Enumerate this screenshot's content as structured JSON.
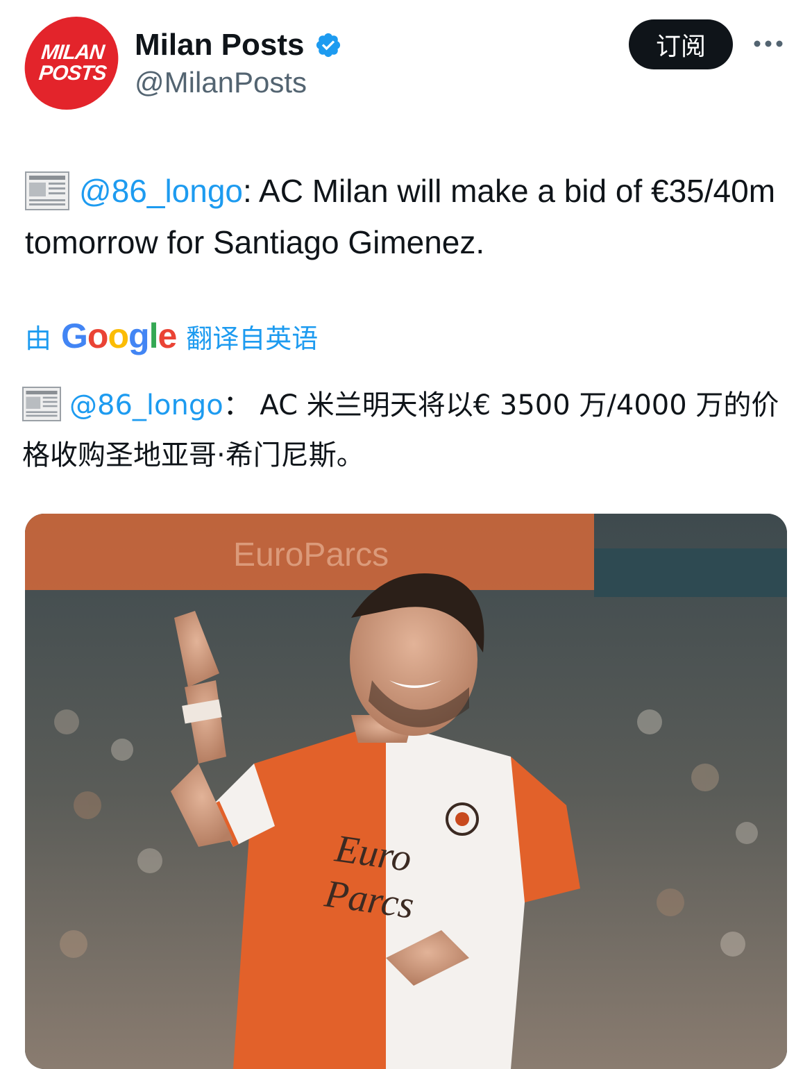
{
  "profile": {
    "avatar_line1": "MILAN",
    "avatar_line2": "POSTS",
    "display_name": "Milan Posts",
    "handle": "@MilanPosts",
    "verified_icon": "verified-badge-icon",
    "verified_color": "#1d9bf0"
  },
  "actions": {
    "subscribe_label": "订阅",
    "more_icon": "more-dots-icon"
  },
  "tweet": {
    "en_mention": "@86_longo",
    "en_text": ": AC Milan will make a bid of €35/40m tomorrow for Santiago Gimenez.",
    "translate_prefix": "由",
    "translate_brand": "Google",
    "translate_suffix": "翻译自英语",
    "zh_mention": "@86_longo",
    "zh_text": "： AC 米兰明天将以€ 3500 万/4000 万的价格收购圣地亚哥·希门尼斯。",
    "icon": "newspaper-icon",
    "mention_color": "#1d9bf0"
  },
  "photo": {
    "sponsor_line1": "Euro",
    "sponsor_line2": "Parcs",
    "banner_text": "EuroParcs",
    "jersey_colors": [
      "#e2612a",
      "#ffffff"
    ]
  }
}
